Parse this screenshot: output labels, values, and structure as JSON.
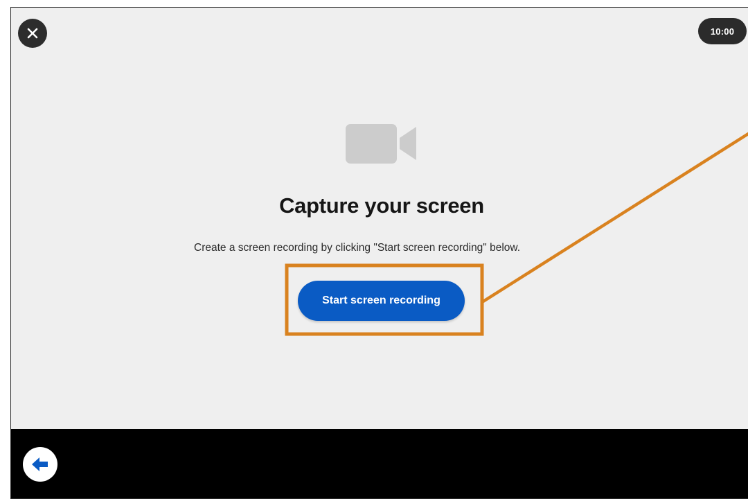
{
  "header": {
    "close_icon": "close-icon",
    "timer": "10:00"
  },
  "main": {
    "icon": "video-camera-icon",
    "title": "Capture your screen",
    "subtitle": "Create a screen recording by clicking \"Start screen recording\" below.",
    "start_button_label": "Start screen recording"
  },
  "footer": {
    "back_icon": "arrow-left-icon"
  },
  "annotation": {
    "highlight_color": "#d9821f"
  },
  "colors": {
    "primary_button": "#0a5bc4",
    "background": "#efefef",
    "footer": "#000000",
    "icon_gray": "#cccccc"
  }
}
